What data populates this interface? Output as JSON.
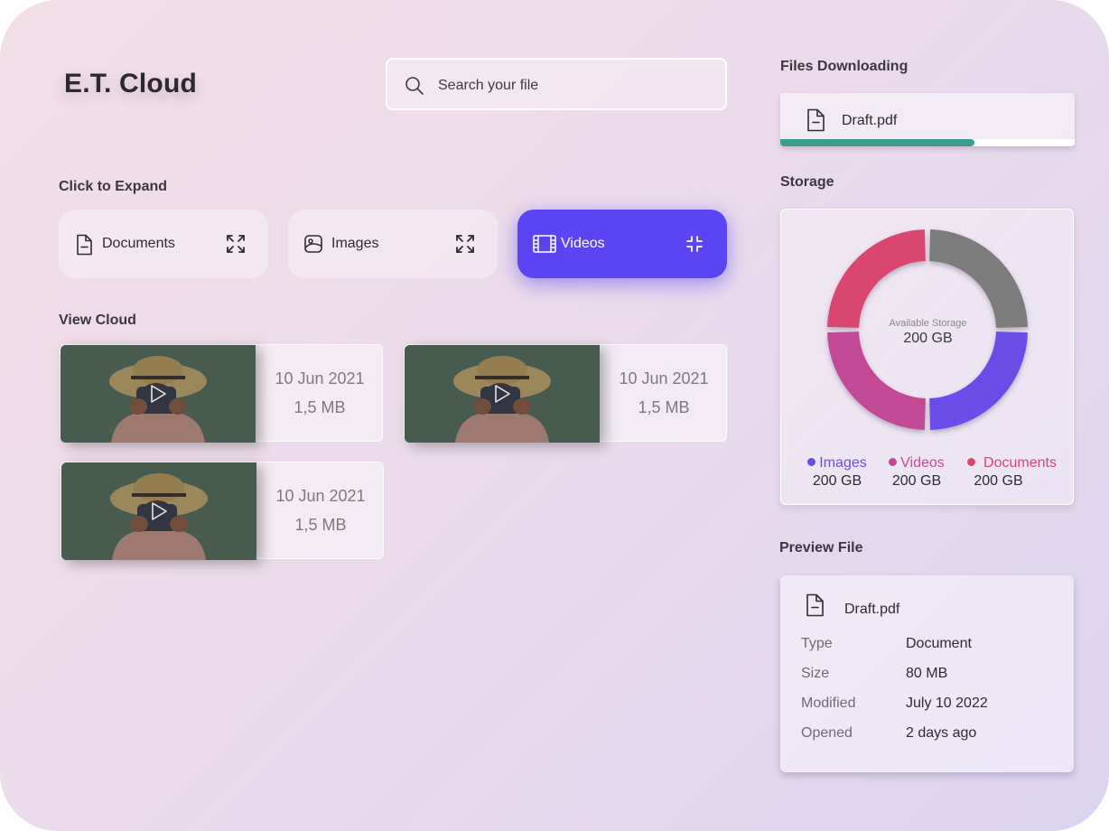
{
  "app": {
    "title": "E.T. Cloud"
  },
  "search": {
    "placeholder": "Search your file",
    "icon": "search-icon"
  },
  "sections": {
    "expand": "Click to Expand",
    "view_cloud": "View Cloud",
    "files_downloading": "Files Downloading",
    "storage": "Storage",
    "preview_file": "Preview File"
  },
  "categories": [
    {
      "label": "Documents",
      "icon": "document-icon",
      "toggle_icon": "expand-icon",
      "active": false
    },
    {
      "label": "Images",
      "icon": "image-icon",
      "toggle_icon": "expand-icon",
      "active": false
    },
    {
      "label": "Videos",
      "icon": "film-icon",
      "toggle_icon": "collapse-icon",
      "active": true
    }
  ],
  "videos": [
    {
      "date": "10 Jun 2021",
      "size": "1,5 MB",
      "icon": "play-icon"
    },
    {
      "date": "10 Jun 2021",
      "size": "1,5 MB",
      "icon": "play-icon"
    },
    {
      "date": "10 Jun 2021",
      "size": "1,5 MB",
      "icon": "play-icon"
    }
  ],
  "download": {
    "file_name": "Draft.pdf",
    "progress": 0.66,
    "progress_color": "#3a9f8a"
  },
  "storage": {
    "center_label": "Available Storage",
    "center_value": "200 GB",
    "segments": [
      {
        "name": "Images",
        "color": "#6a4de6"
      },
      {
        "name": "Videos",
        "color": "#c24a93"
      },
      {
        "name": "Documents",
        "color": "#d9466f"
      },
      {
        "name": "Available",
        "color": "#7b7b7b"
      }
    ],
    "legend": [
      {
        "name": "Images",
        "amount": "200 GB",
        "color": "#6a4de6"
      },
      {
        "name": "Videos",
        "amount": "200 GB",
        "color": "#c24a93"
      },
      {
        "name": "Documents",
        "amount": "200 GB",
        "color": "#d9466f"
      }
    ]
  },
  "preview": {
    "file_name": "Draft.pdf",
    "rows": [
      {
        "key": "Type",
        "value": "Document"
      },
      {
        "key": "Size",
        "value": "80 MB"
      },
      {
        "key": "Modified",
        "value": "July 10 2022"
      },
      {
        "key": "Opened",
        "value": "2 days ago"
      }
    ]
  },
  "colors": {
    "accent": "#5b45f2"
  }
}
